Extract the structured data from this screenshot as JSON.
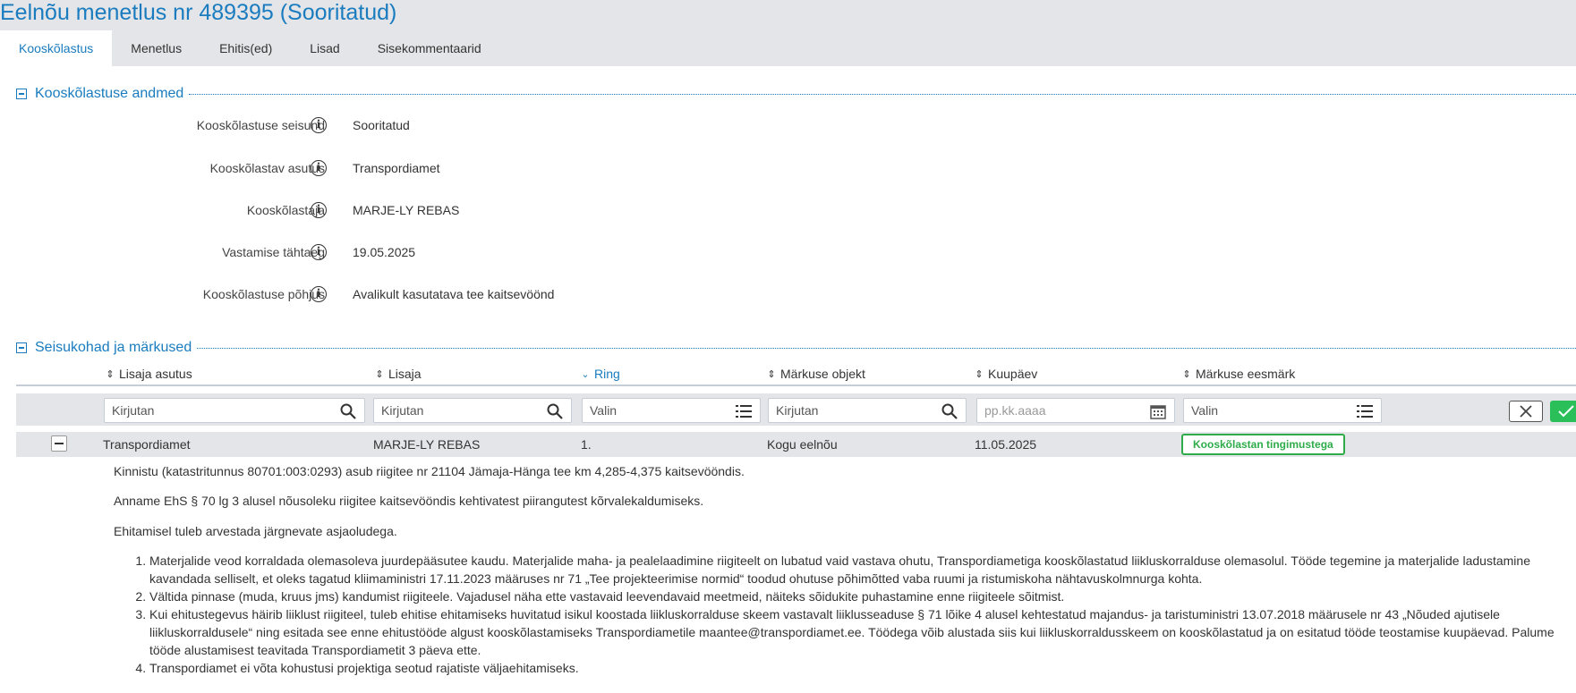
{
  "page": {
    "title": "Eelnõu menetlus nr 489395 (Sooritatud)"
  },
  "tabs": [
    {
      "label": "Kooskõlastus",
      "active": true
    },
    {
      "label": "Menetlus",
      "active": false
    },
    {
      "label": "Ehitis(ed)",
      "active": false
    },
    {
      "label": "Lisad",
      "active": false
    },
    {
      "label": "Sisekommentaarid",
      "active": false
    }
  ],
  "approval_section": {
    "title": "Kooskõlastuse andmed",
    "fields": [
      {
        "label": "Kooskõlastuse seisund",
        "value": "Sooritatud"
      },
      {
        "label": "Kooskõlastav asutus",
        "value": "Transpordiamet"
      },
      {
        "label": "Kooskõlastaja",
        "value": "MARJE-LY REBAS"
      },
      {
        "label": "Vastamise tähtaeg",
        "value": "19.05.2025"
      },
      {
        "label": "Kooskõlastuse põhjus",
        "value": "Avalikult kasutatava tee kaitsevöönd"
      }
    ]
  },
  "remarks_section": {
    "title": "Seisukohad ja märkused",
    "columns": [
      {
        "label": "Lisaja asutus",
        "sorted": false
      },
      {
        "label": "Lisaja",
        "sorted": false
      },
      {
        "label": "Ring",
        "sorted": true
      },
      {
        "label": "Märkuse objekt",
        "sorted": false
      },
      {
        "label": "Kuupäev",
        "sorted": false
      },
      {
        "label": "Märkuse eesmärk",
        "sorted": false
      }
    ],
    "filters": {
      "agency_placeholder": "Kirjutan",
      "adder_placeholder": "Kirjutan",
      "round_placeholder": "Valin",
      "object_placeholder": "Kirjutan",
      "date_placeholder": "pp.kk.aaaa",
      "purpose_placeholder": "Valin"
    },
    "row": {
      "agency": "Transpordiamet",
      "adder": "MARJE-LY REBAS",
      "round": "1.",
      "object": "Kogu eelnõu",
      "date": "11.05.2025",
      "purpose": "Kooskõlastan tingimustega"
    },
    "details": {
      "paragraphs": [
        "Kinnistu (katastritunnus 80701:003:0293) asub riigitee nr 21104 Jämaja-Hänga tee km 4,285-4,375 kaitsevööndis.",
        "Anname EhS § 70 lg 3 alusel nõusoleku riigitee kaitsevööndis kehtivatest piirangutest kõrvalekaldumiseks.",
        "Ehitamisel tuleb arvestada järgnevate asjaoludega."
      ],
      "conditions": [
        "Materjalide veod korraldada olemasoleva juurdepääsutee kaudu. Materjalide maha- ja pealelaadimine riigiteelt on lubatud vaid vastava ohutu, Transpordiametiga kooskõlastatud liikluskorralduse olemasolul. Tööde tegemine ja materjalide ladustamine kavandada selliselt, et oleks tagatud kliimaministri 17.11.2023 määruses nr 71 „Tee projekteerimise normid“ toodud ohutuse põhimõtted vaba ruumi ja ristumiskoha nähtavuskolmnurga kohta.",
        "Vältida pinnase (muda, kruus jms) kandumist riigiteele. Vajadusel näha ette vastavaid leevendavaid meetmeid, näiteks sõidukite puhastamine enne riigiteele sõitmist.",
        "Kui ehitustegevus häirib liiklust riigiteel, tuleb ehitise ehitamiseks huvitatud isikul koostada liikluskorralduse skeem vastavalt liiklusseaduse § 71 lõike 4 alusel kehtestatud majandus- ja taristuministri 13.07.2018 määrusele nr 43 „Nõuded ajutisele liikluskorraldusele“ ning esitada see enne ehitustööde algust kooskõlastamiseks Transpordiametile maantee@transpordiamet.ee. Töödega võib alustada siis kui liikluskorraldusskeem on kooskõlastatud ja on esitatud tööde teostamise kuupäevad. Palume tööde alustamisest teavitada Transpordiametit 3 päeva ette.",
        "Transpordiamet ei võta kohustusi projektiga seotud rajatiste väljaehitamiseks."
      ]
    }
  },
  "icons": {
    "info": "info-icon",
    "search": "search-icon",
    "list": "list-icon",
    "calendar": "calendar-icon",
    "clear": "close-icon",
    "apply": "check-icon",
    "sort": "sort-icon"
  },
  "colors": {
    "accent": "#1a7cbf",
    "success": "#2eac4a",
    "bar": "#e3e5e8"
  }
}
